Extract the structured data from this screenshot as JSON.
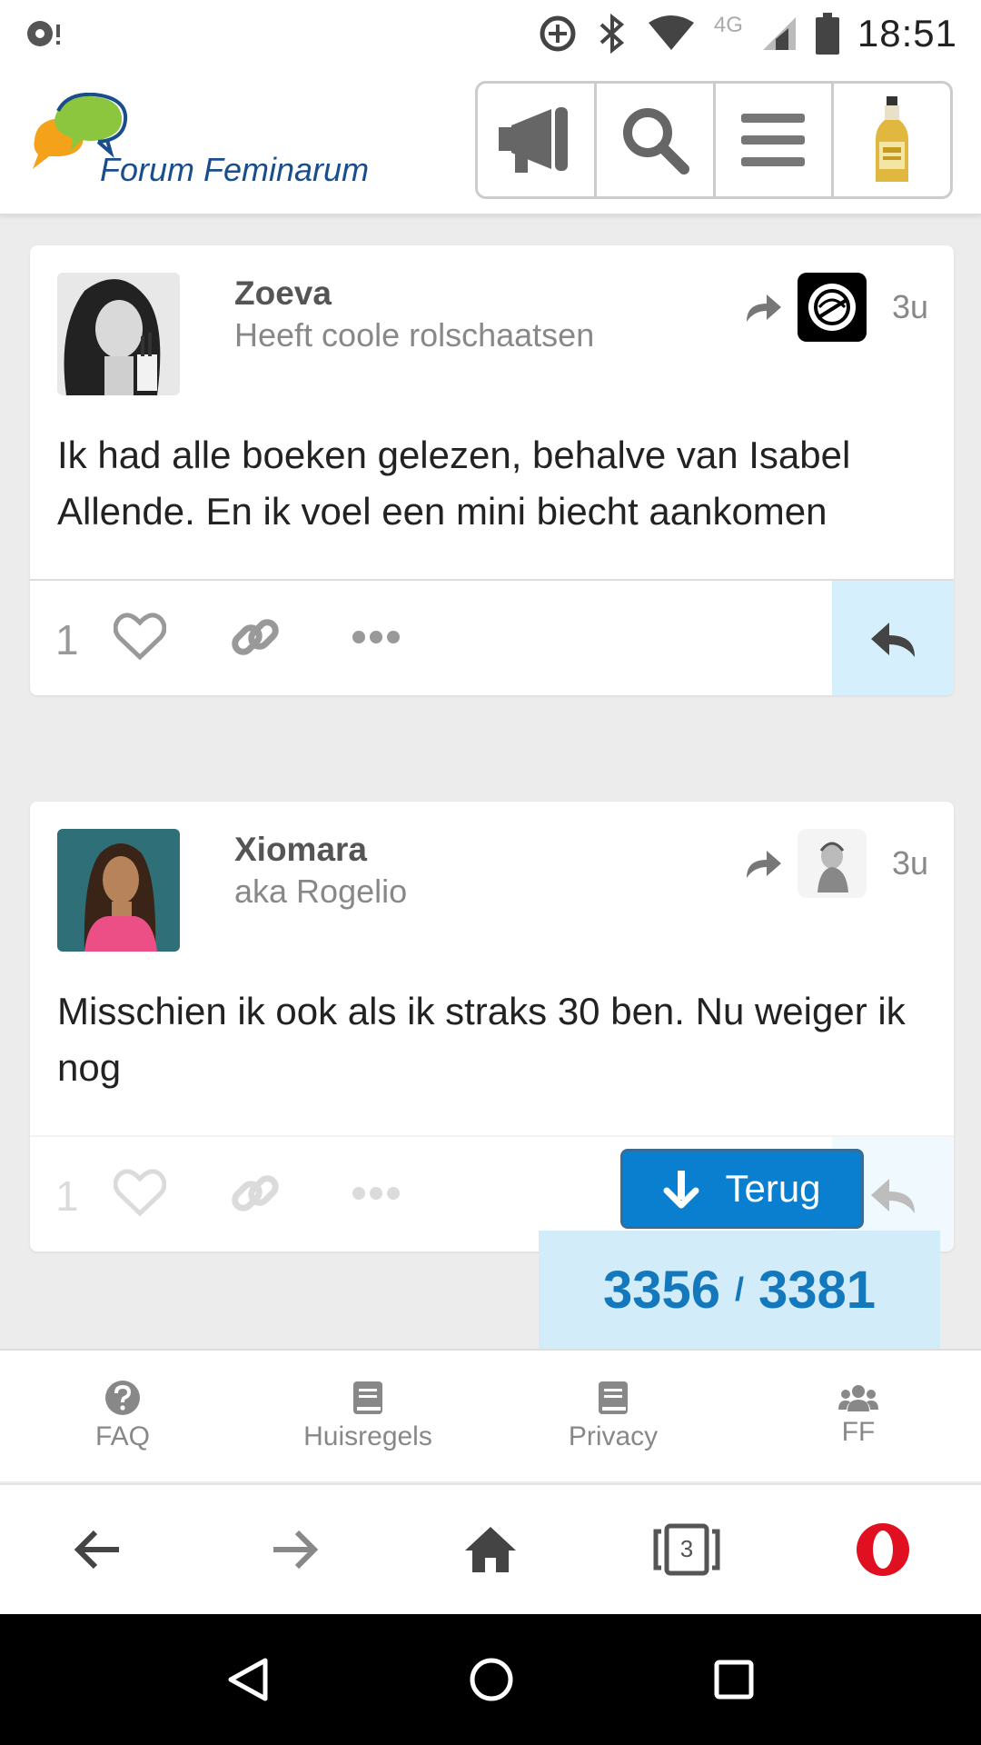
{
  "status_bar": {
    "network": "4G",
    "time": "18:51"
  },
  "header": {
    "logo_text": "Forum Feminarum"
  },
  "posts": [
    {
      "author": "Zoeva",
      "user_title": "Heeft coole rolschaatsen",
      "time": "3u",
      "body": "Ik had alle boeken gelezen, behalve van Isabel Allende. En ik voel een mini biecht aankomen",
      "likes": "1"
    },
    {
      "author": "Xiomara",
      "user_title": "aka Rogelio",
      "time": "3u",
      "body": "Misschien ik ook als ik straks 30 ben. Nu weiger ik nog",
      "likes": "1"
    }
  ],
  "timeline": {
    "back_label": "Terug",
    "current": "3356",
    "separator": "/",
    "total": "3381"
  },
  "footer_links": [
    {
      "label": "FAQ",
      "icon": "question-circle-icon"
    },
    {
      "label": "Huisregels",
      "icon": "book-icon"
    },
    {
      "label": "Privacy",
      "icon": "book-icon"
    },
    {
      "label": "FF",
      "icon": "users-icon"
    }
  ],
  "browser": {
    "tab_count": "3"
  },
  "colors": {
    "accent": "#0a7fd0",
    "reply_bg": "#d6effc",
    "counter_bg": "#d3ecf9",
    "counter_text": "#1478bd",
    "opera_red": "#e01020"
  }
}
